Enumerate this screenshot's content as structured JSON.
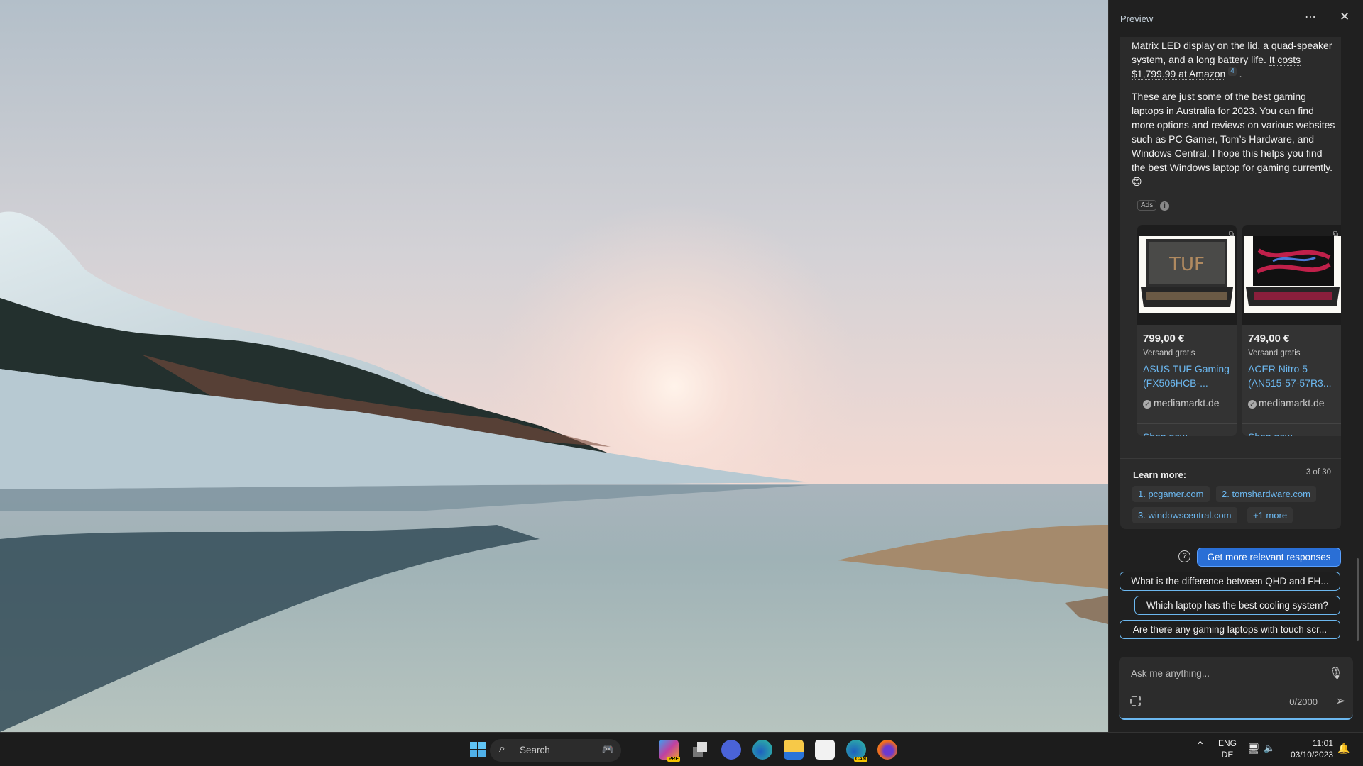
{
  "panel": {
    "title": "Preview",
    "more_icon": "more-icon",
    "close_icon": "close-icon",
    "message": {
      "p1_start": "Matrix LED display on the lid, a quad-speaker system, and a long battery life. ",
      "p1_link": "It costs $1,799.99 at Amazon",
      "p1_cite": "4",
      "p1_end": " .",
      "p2": "These are just some of the best gaming laptops in Australia for 2023. You can find more options and reviews on various websites such as PC Gamer, Tom’s Hardware, and Windows Central. I hope this helps you find the best Windows laptop for gaming currently. ",
      "emoji": "😊"
    },
    "ads_label": "Ads",
    "products": [
      {
        "price": "799,00 €",
        "shipping": "Versand gratis",
        "name": "ASUS TUF Gaming (FX506HCB-...",
        "seller": "mediamarkt.de",
        "action": "Shop now"
      },
      {
        "price": "749,00 €",
        "shipping": "Versand gratis",
        "name": "ACER Nitro 5 (AN515-57-57R3...",
        "seller": "mediamarkt.de",
        "action": "Shop now"
      }
    ],
    "learn_more": {
      "label": "Learn more:",
      "count": "3 of 30",
      "links": [
        "1. pcgamer.com",
        "2. tomshardware.com",
        "3. windowscentral.com",
        "+1 more"
      ]
    },
    "get_more": "Get more relevant responses",
    "suggestions": [
      "What is the difference between QHD and FH...",
      "Which laptop has the best cooling system?",
      "Are there any gaming laptops with touch scr..."
    ],
    "input": {
      "placeholder": "Ask me anything...",
      "char_count": "0/2000"
    }
  },
  "taskbar": {
    "search": "Search",
    "preview_badge": "PRE",
    "canary_badge": "CAN",
    "tray": {
      "lang1": "ENG",
      "lang2": "DE",
      "time": "11:01",
      "date": "03/10/2023"
    }
  }
}
